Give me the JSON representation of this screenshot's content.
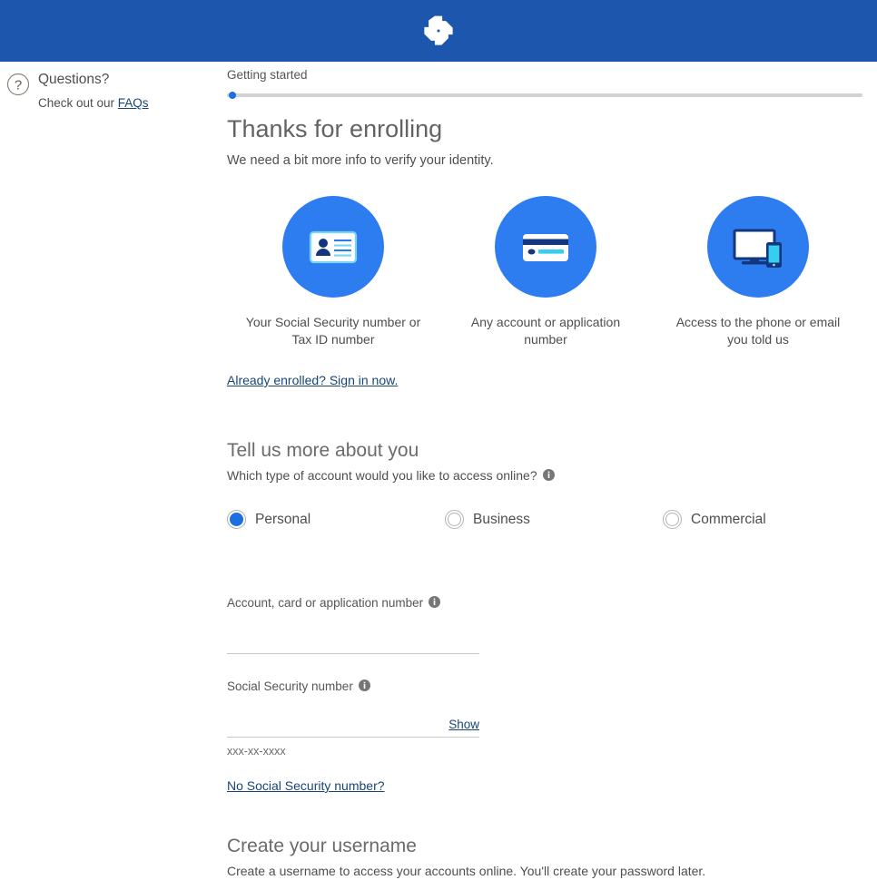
{
  "header": {
    "logo_name": "chase-octagon-logo",
    "brand_color": "#1c56ad"
  },
  "help_rail": {
    "icon": "question-mark-circle-icon",
    "title": "Questions?",
    "sub_prefix": "Check out our ",
    "faq_link": "FAQs"
  },
  "progress": {
    "step_label": "Getting started",
    "percent": 1,
    "dot_color": "#1c6fe0",
    "track_color": "#d2d2d2"
  },
  "intro": {
    "headline": "Thanks for enrolling",
    "subhead": "We need a bit more info to verify your identity."
  },
  "requirements": [
    {
      "icon": "id-card-icon",
      "caption": "Your Social Security number or Tax ID number"
    },
    {
      "icon": "credit-card-icon",
      "caption": "Any account or application number"
    },
    {
      "icon": "monitor-phone-icon",
      "caption": "Access to the phone or email you told us"
    }
  ],
  "signin": {
    "link": "Already enrolled? Sign in now."
  },
  "tell_us": {
    "title": "Tell us more about you",
    "question": "Which type of account would you like to access online?",
    "info_icon": "info-icon",
    "options": [
      {
        "label": "Personal",
        "selected": true
      },
      {
        "label": "Business",
        "selected": false
      },
      {
        "label": "Commercial",
        "selected": false
      }
    ]
  },
  "account_field": {
    "label": "Account, card or application number",
    "info_icon": "info-icon",
    "value": "",
    "placeholder": ""
  },
  "ssn_field": {
    "label": "Social Security number",
    "info_icon": "info-icon",
    "value": "",
    "placeholder": "",
    "show_label": "Show",
    "hint": "xxx-xx-xxxx",
    "no_ssn_link": "No Social Security number?"
  },
  "username_section": {
    "title": "Create your username",
    "sub": "Create a username to access your accounts online. You'll create your password later."
  }
}
